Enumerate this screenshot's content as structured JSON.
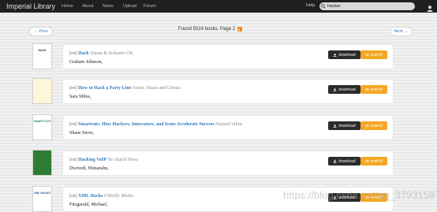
{
  "navbar": {
    "brand": "Imperial Library",
    "items": [
      "Home",
      "About",
      "News",
      "Upload",
      "Forum"
    ],
    "help": "Help",
    "search_value": "hacker"
  },
  "pagination": {
    "prev": "← Prev",
    "next": "Next →",
    "found": "Found 5024 books. Page 2"
  },
  "buttons": {
    "download": "download",
    "read": "read it!"
  },
  "books": [
    {
      "tag": "[en]",
      "title": "Hack",
      "publisher": "Simon & Schuster UK",
      "author": "Graham Johnson,"
    },
    {
      "tag": "[en]",
      "title": "How to Hack a Party Line",
      "publisher": "Farrar, Straus and Giroux",
      "author": "Sara Miles,"
    },
    {
      "tag": "[en]",
      "title": "Smartcuts: How Hackers, Innovators, and Icons Accelerate Success",
      "publisher": "HarperCollins",
      "author": "Shane Snow,"
    },
    {
      "tag": "[en]",
      "title": "Hacking VoIP",
      "publisher": "No Starch Press",
      "author": "Dwivedi, Himanshu,"
    },
    {
      "tag": "[en]",
      "title": "XML Hacks",
      "publisher": "O'Reilly Media",
      "author": "Fitzgerald, Michael,"
    }
  ],
  "covers": [
    {
      "text": "HACK",
      "bg": "#ffffff",
      "fg": "#333333"
    },
    {
      "text": "",
      "bg": "#fdf6d8",
      "fg": "#c9a23a"
    },
    {
      "text": "SMARTCUTS",
      "bg": "#ffffff",
      "fg": "#2a8a6a"
    },
    {
      "text": "",
      "bg": "#2f7d32",
      "fg": "#c8e6c9"
    },
    {
      "text": "XML HACKS",
      "bg": "#ffffff",
      "fg": "#1a5a9a"
    }
  ],
  "watermark": "https://blog.csdn.net/qq_37931597"
}
